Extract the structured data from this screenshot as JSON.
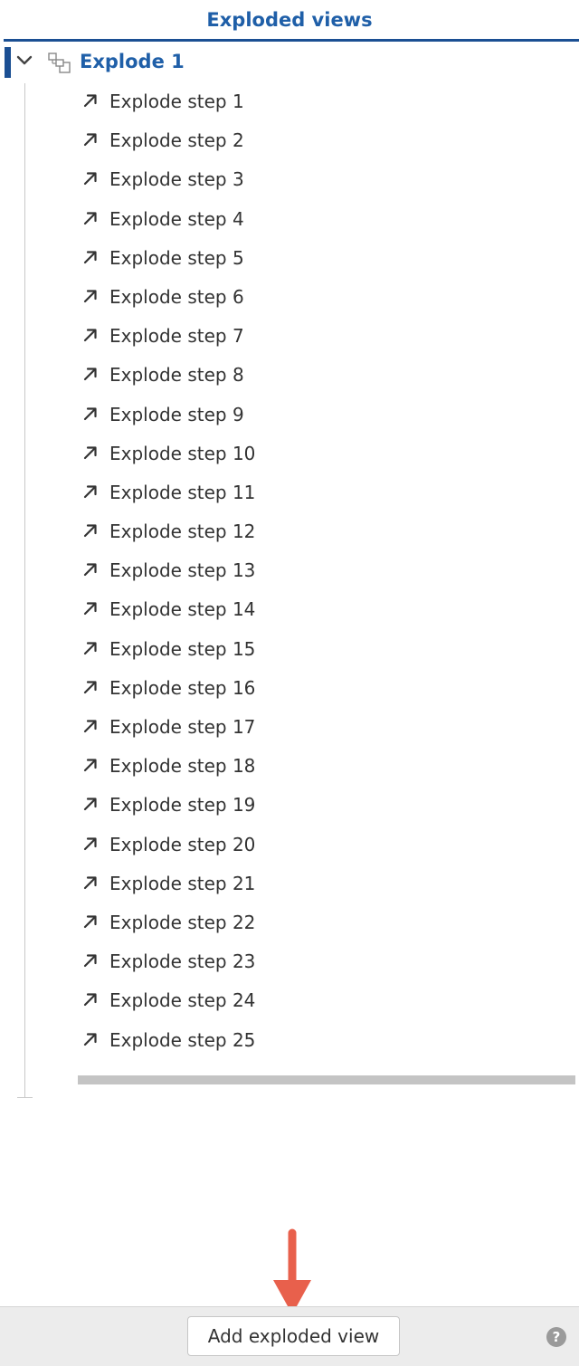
{
  "panel": {
    "title": "Exploded views"
  },
  "tree": {
    "parent": {
      "label": "Explode 1",
      "expand_icon": "chevron-down-icon",
      "type_icon": "assembly-icon"
    },
    "step_icon": "arrow-up-right-icon",
    "steps": [
      {
        "label": "Explode step 1"
      },
      {
        "label": "Explode step 2"
      },
      {
        "label": "Explode step 3"
      },
      {
        "label": "Explode step 4"
      },
      {
        "label": "Explode step 5"
      },
      {
        "label": "Explode step 6"
      },
      {
        "label": "Explode step 7"
      },
      {
        "label": "Explode step 8"
      },
      {
        "label": "Explode step 9"
      },
      {
        "label": "Explode step 10"
      },
      {
        "label": "Explode step 11"
      },
      {
        "label": "Explode step 12"
      },
      {
        "label": "Explode step 13"
      },
      {
        "label": "Explode step 14"
      },
      {
        "label": "Explode step 15"
      },
      {
        "label": "Explode step 16"
      },
      {
        "label": "Explode step 17"
      },
      {
        "label": "Explode step 18"
      },
      {
        "label": "Explode step 19"
      },
      {
        "label": "Explode step 20"
      },
      {
        "label": "Explode step 21"
      },
      {
        "label": "Explode step 22"
      },
      {
        "label": "Explode step 23"
      },
      {
        "label": "Explode step 24"
      },
      {
        "label": "Explode step 25"
      }
    ]
  },
  "footer": {
    "add_button_label": "Add exploded view",
    "help_icon": "question-mark-icon",
    "help_glyph": "?"
  },
  "annotation": {
    "icon": "red-callout-arrow-icon"
  },
  "colors": {
    "accent": "#1f5fa8",
    "selection": "#1b4f93",
    "callout": "#e8604c",
    "footer_bg": "#ececec"
  }
}
